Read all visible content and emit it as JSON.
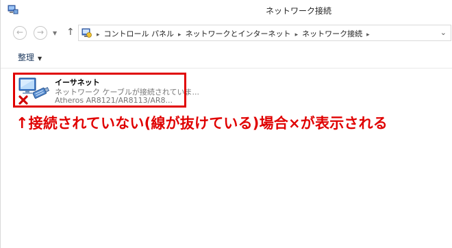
{
  "window": {
    "title": "ネットワーク接続"
  },
  "nav": {
    "back_glyph": "←",
    "forward_glyph": "→",
    "up_glyph": "↑",
    "recent_glyph": "▼"
  },
  "address": {
    "crumbs": [
      "コントロール パネル",
      "ネットワークとインターネット",
      "ネットワーク接続"
    ],
    "separator": "▸",
    "dropdown_glyph": "⌄"
  },
  "commandbar": {
    "organize_label": "整理",
    "organize_caret": "▼"
  },
  "connection": {
    "name": "イーサネット",
    "status": "ネットワーク ケーブルが接続されていま...",
    "device": "Atheros AR8121/AR8113/AR8..."
  },
  "annotation": {
    "arrow": "↑",
    "text": "接続されていない(線が抜けている)場合×が表示される"
  },
  "colors": {
    "highlight": "#e00000",
    "annotation": "#e00000"
  }
}
